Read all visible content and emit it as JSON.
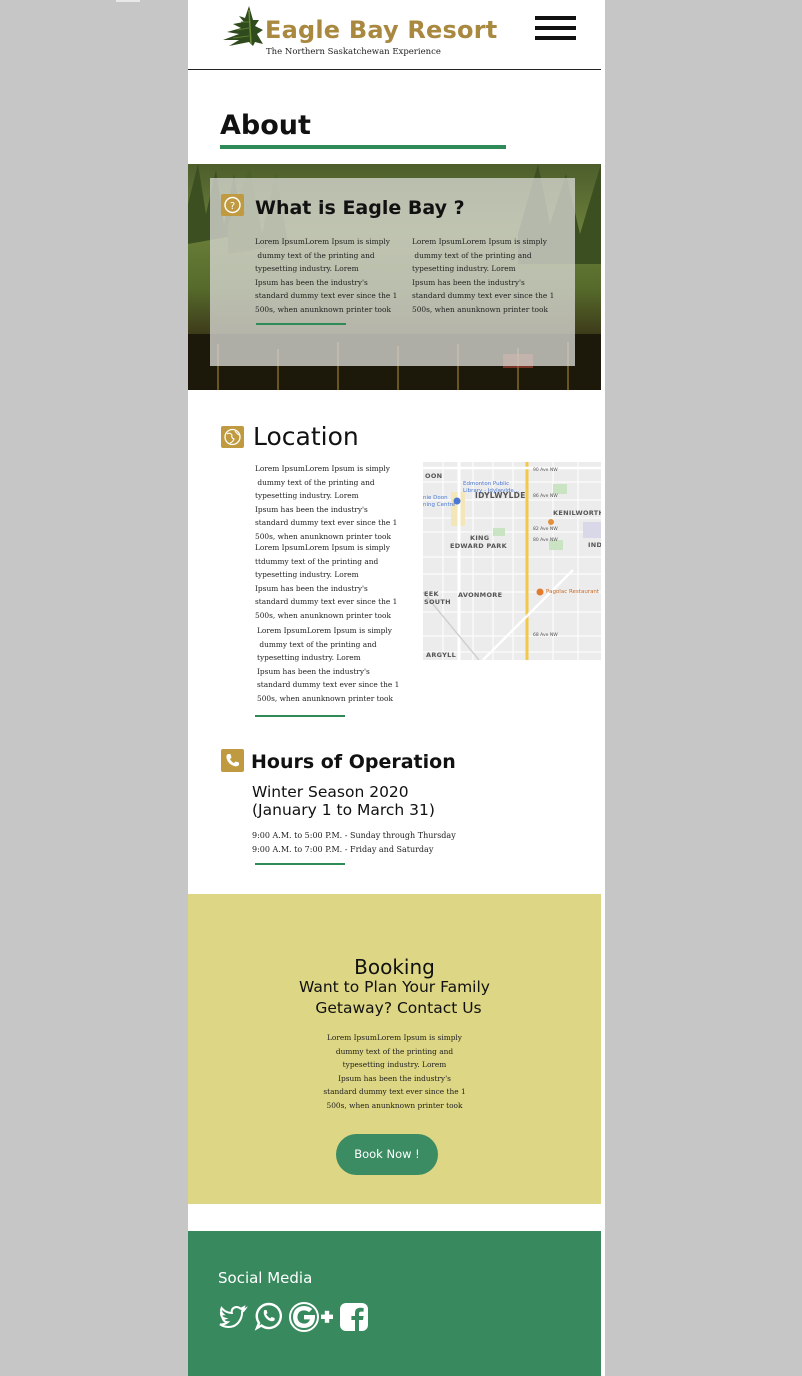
{
  "header": {
    "title": "Eagle Bay Resort",
    "tagline": "The Northern Saskatchewan Experience",
    "menu_icon": "hamburger-menu-icon"
  },
  "about": {
    "title": "About"
  },
  "what": {
    "icon": "question-mark-icon",
    "title": "What is Eagle Bay ?",
    "col1": "Lorem IpsumLorem Ipsum is simply\n dummy text of the printing and\ntypesetting industry. Lorem\nIpsum has been the industry's\nstandard dummy text ever since the 1\n500s, when anunknown printer took",
    "col2": "Lorem IpsumLorem Ipsum is simply\n dummy text of the printing and\ntypesetting industry. Lorem\nIpsum has been the industry's\nstandard dummy text ever since the 1\n500s, when anunknown printer took"
  },
  "location": {
    "icon": "globe-icon",
    "title": "Location",
    "p1": "Lorem IpsumLorem Ipsum is simply\n dummy text of the printing and\ntypesetting industry. Lorem\nIpsum has been the industry's\nstandard dummy text ever since the 1\n500s, when anunknown printer took",
    "p2": "Lorem IpsumLorem Ipsum is simply\nttdummy text of the printing and\ntypesetting industry. Lorem\nIpsum has been the industry's\nstandard dummy text ever since the 1\n500s, when anunknown printer took",
    "p3": "Lorem IpsumLorem Ipsum is simply\n dummy text of the printing and\ntypesetting industry. Lorem\nIpsum has been the industry's\nstandard dummy text ever since the 1\n500s, when anunknown printer took",
    "map": {
      "labels": [
        "OON",
        "IDYLWYLDE",
        "KENILWORTH",
        "KING",
        "EDWARD PARK",
        "AVONMORE",
        "EEK",
        "SOUTH",
        "ARGYLL",
        "IND"
      ],
      "poi_library": "Edmonton Public\nLibrary - Idylwylde...",
      "poi_centre": "nie Doon\nning Centre",
      "poi_restaurant": "Pagolac Restaurant",
      "roads": [
        "90 Ave NW",
        "86 Ave NW",
        "82 Ave NW",
        "80 Ave NW",
        "75 Street NW",
        "83 St NW",
        "85 St NW",
        "68 Ave NW",
        "63 St NW"
      ]
    }
  },
  "hours": {
    "icon": "phone-icon",
    "title": "Hours of Operation",
    "season_line1": "Winter Season 2020",
    "season_line2": "(January 1 to March 31)",
    "line1": "9:00 A.M. to 5:00 P.M. - Sunday through Thursday",
    "line2": "9:00 A.M. to 7:00 P.M. - Friday and Saturday"
  },
  "booking": {
    "title": "Booking",
    "subtitle1": "Want to Plan Your Family",
    "subtitle2": "Getaway? Contact Us",
    "text": "Lorem IpsumLorem Ipsum is simply\ndummy text of the printing and\ntypesetting industry. Lorem\nIpsum has been the industry's\nstandard dummy text ever since the 1\n500s, when anunknown printer took",
    "button": "Book Now !"
  },
  "footer": {
    "social_title": "Social Media",
    "icons": [
      "twitter-icon",
      "whatsapp-icon",
      "google-plus-icon",
      "facebook-icon"
    ]
  },
  "colors": {
    "gold": "#a98840",
    "green": "#2e8b57",
    "booking_bg": "#ddd684",
    "footer_bg": "#388a5e"
  }
}
